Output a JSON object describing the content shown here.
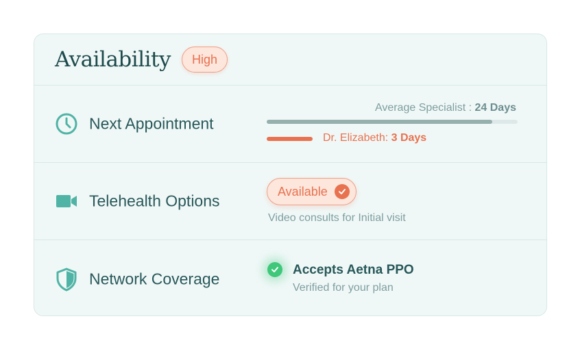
{
  "header": {
    "title": "Availability",
    "level_badge": "High"
  },
  "next_appointment": {
    "label": "Next Appointment",
    "icon": "clock-icon",
    "average_prefix": "Average Specialist : ",
    "average_value": "24 Days",
    "average_fraction": 0.9,
    "doctor_prefix": "Dr. Elizabeth: ",
    "doctor_value": "3 Days"
  },
  "telehealth": {
    "label": "Telehealth Options",
    "icon": "video-camera-icon",
    "status_badge": "Available",
    "description": "Video consults for Initial visit"
  },
  "network": {
    "label": "Network Coverage",
    "icon": "shield-icon",
    "accepts": "Accepts Aetna PPO",
    "verified": "Verified for your plan"
  },
  "colors": {
    "teal_icon": "#4fb3a5",
    "accent_orange": "#e8724f",
    "success_green": "#3fc77a",
    "heading": "#1d4a4c"
  }
}
